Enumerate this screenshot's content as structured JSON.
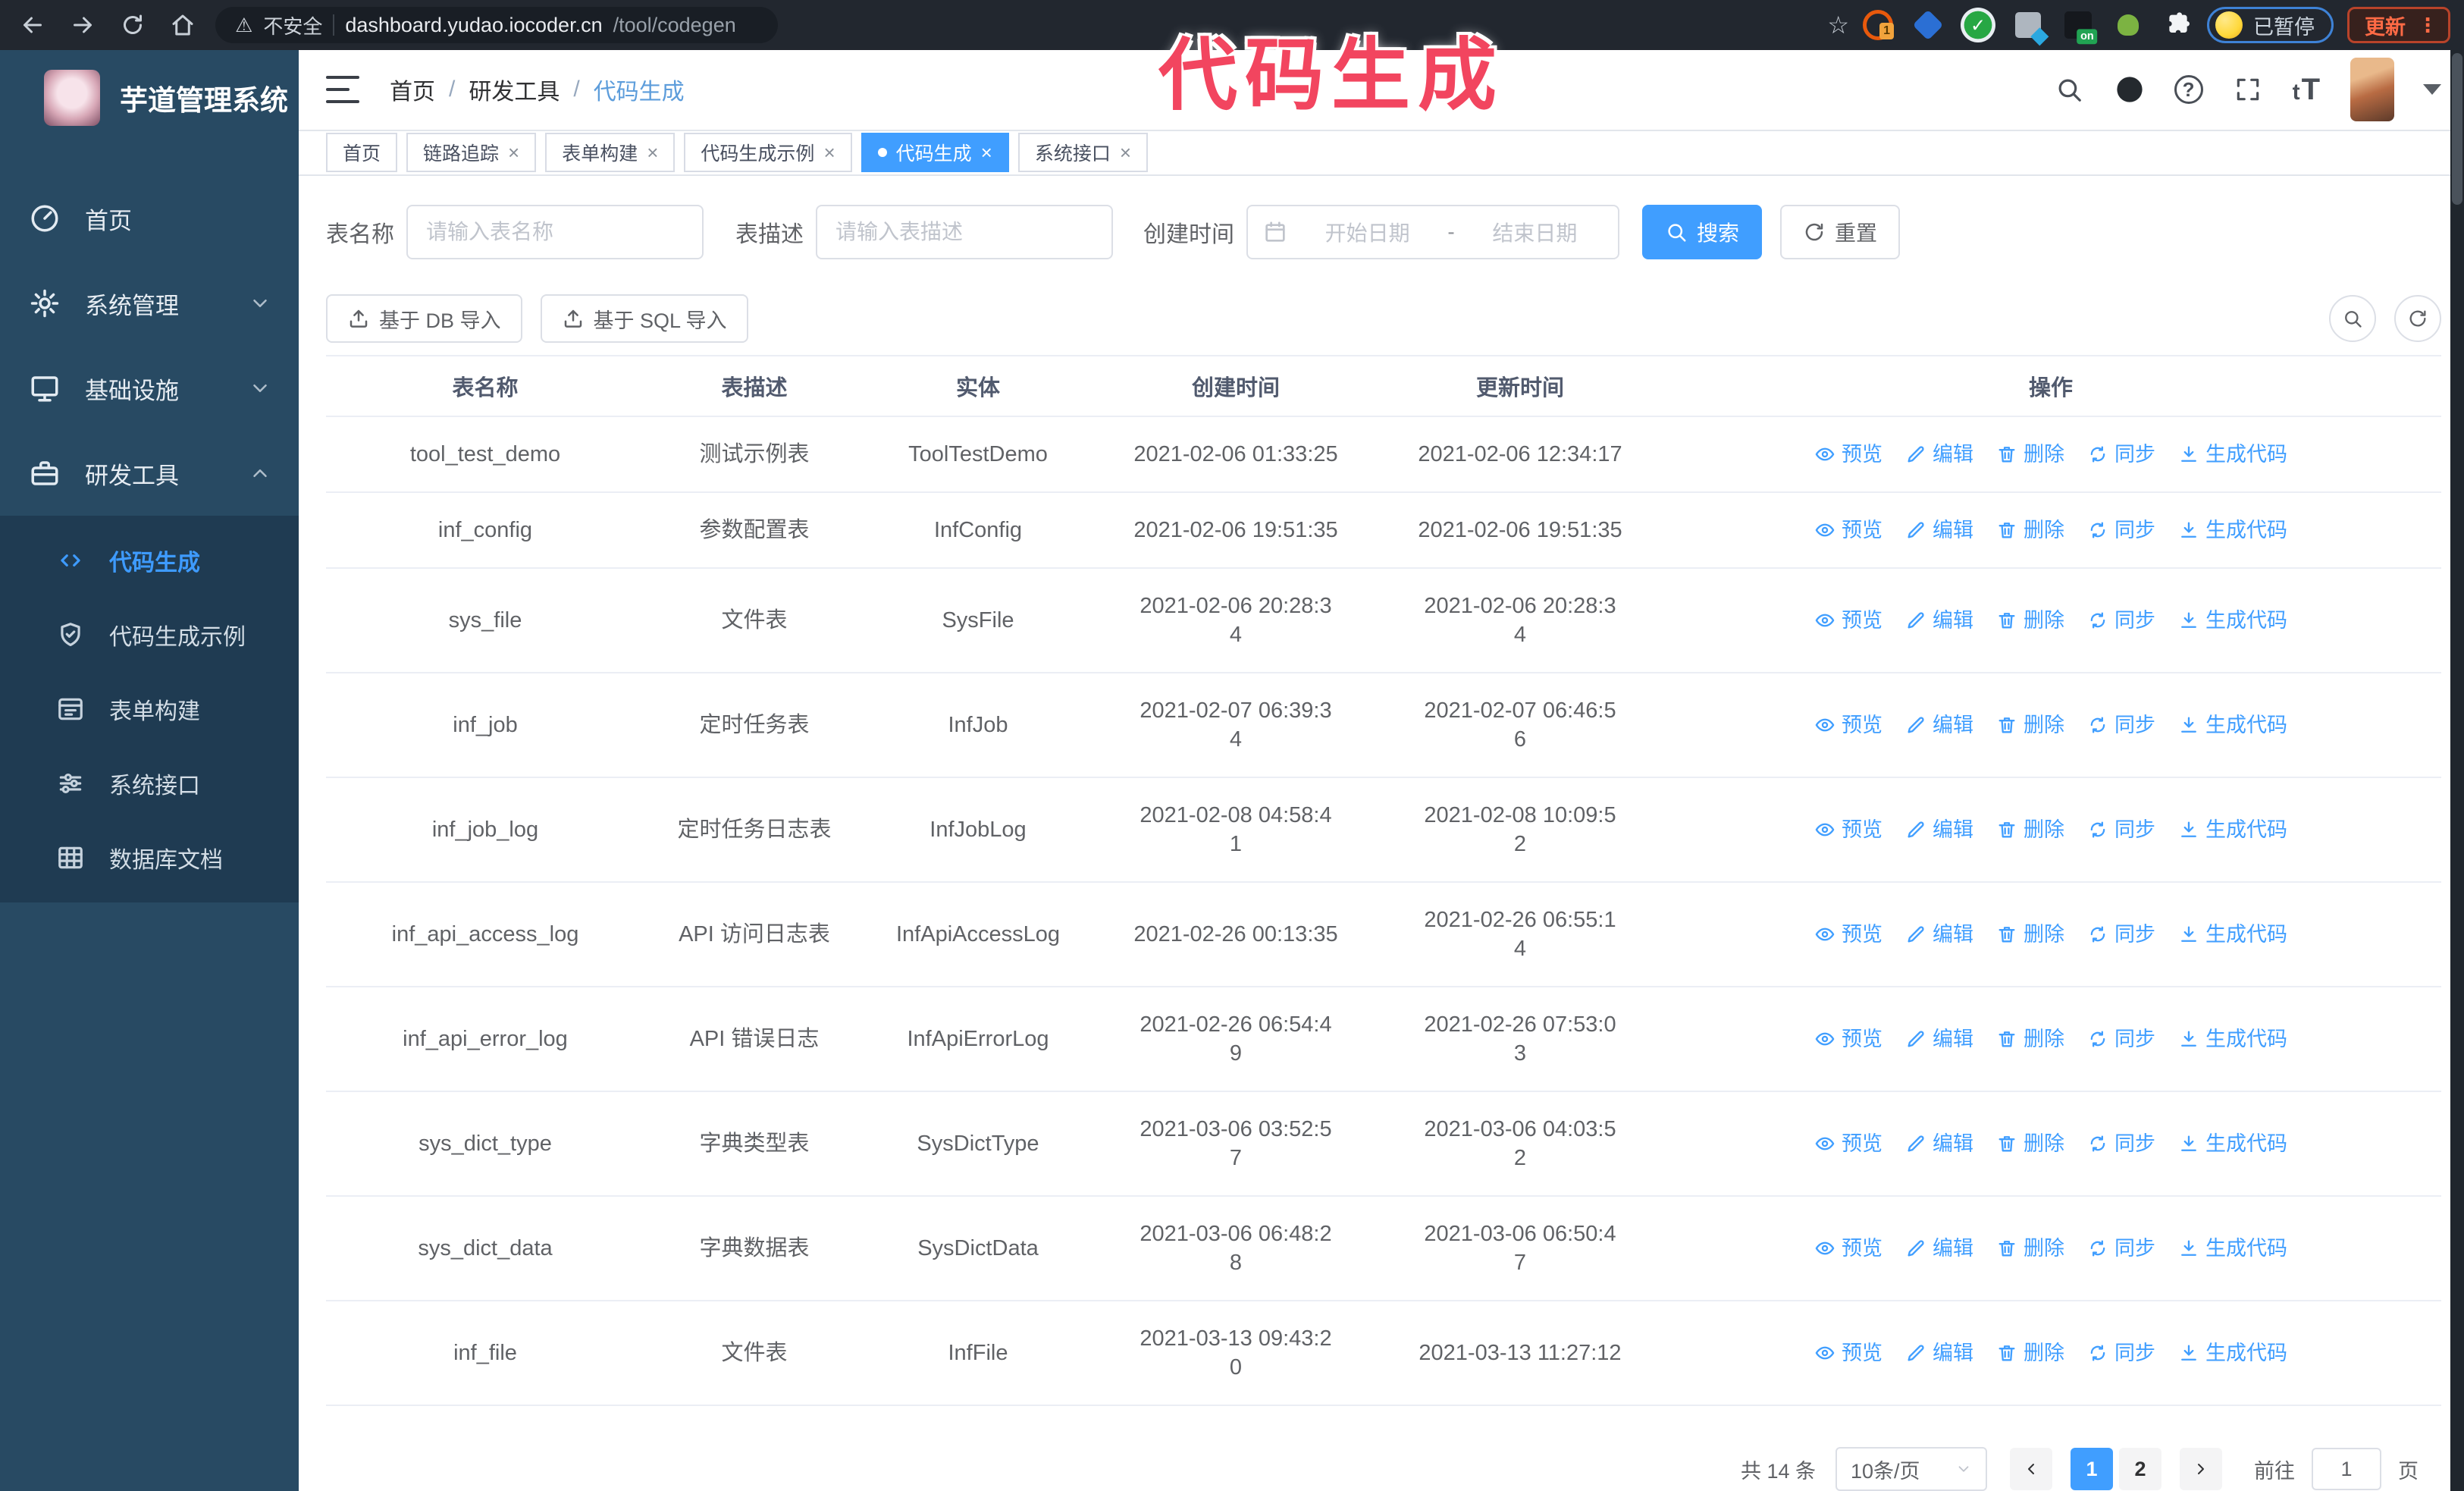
{
  "browser": {
    "security_label": "不安全",
    "url_host": "dashboard.yudao.iocoder.cn",
    "url_path": "/tool/codegen",
    "paused_badge": "已暂停",
    "update_button": "更新",
    "menu_dots": "⋮",
    "warning_glyph": "⚠",
    "star_glyph": "☆",
    "extensions": [
      {
        "name": "orange-extension-icon",
        "badge": "1"
      },
      {
        "name": "gem-extension-icon",
        "badge": ""
      },
      {
        "name": "green-check-extension-icon",
        "badge": "",
        "glyph": "✓"
      },
      {
        "name": "grid-extension-icon",
        "badge": ""
      },
      {
        "name": "dark-on-extension-icon",
        "badge": "on"
      },
      {
        "name": "green-bot-extension-icon",
        "badge": ""
      },
      {
        "name": "puzzle-extension-icon",
        "badge": ""
      }
    ]
  },
  "annotation": {
    "text": "代码生成",
    "color": "#f2455f"
  },
  "sidebar": {
    "title": "芋道管理系统",
    "items": [
      {
        "label": "首页",
        "icon": "dashboard",
        "type": "main"
      },
      {
        "label": "系统管理",
        "icon": "gear",
        "type": "main",
        "chevron": "down"
      },
      {
        "label": "基础设施",
        "icon": "monitor",
        "type": "main",
        "chevron": "down"
      },
      {
        "label": "研发工具",
        "icon": "toolbox",
        "type": "main",
        "chevron": "up"
      },
      {
        "label": "代码生成",
        "icon": "code",
        "type": "sub",
        "active": true
      },
      {
        "label": "代码生成示例",
        "icon": "shield",
        "type": "sub"
      },
      {
        "label": "表单构建",
        "icon": "form",
        "type": "sub"
      },
      {
        "label": "系统接口",
        "icon": "sliders",
        "type": "sub"
      },
      {
        "label": "数据库文档",
        "icon": "tablegrid",
        "type": "sub"
      }
    ]
  },
  "header": {
    "breadcrumb": [
      "首页",
      "研发工具",
      "代码生成"
    ],
    "separator": "/",
    "text_size_icon": "tT"
  },
  "tabs": [
    {
      "label": "首页",
      "closable": false,
      "active": false
    },
    {
      "label": "链路追踪",
      "closable": true,
      "active": false
    },
    {
      "label": "表单构建",
      "closable": true,
      "active": false
    },
    {
      "label": "代码生成示例",
      "closable": true,
      "active": false
    },
    {
      "label": "代码生成",
      "closable": true,
      "active": true
    },
    {
      "label": "系统接口",
      "closable": true,
      "active": false
    }
  ],
  "filters": {
    "table_name_label": "表名称",
    "table_name_placeholder": "请输入表名称",
    "table_desc_label": "表描述",
    "table_desc_placeholder": "请输入表描述",
    "create_time_label": "创建时间",
    "date_start_placeholder": "开始日期",
    "date_separator": "-",
    "date_end_placeholder": "结束日期",
    "search_button": "搜索",
    "reset_button": "重置"
  },
  "toolbar": {
    "import_db_button": "基于 DB 导入",
    "import_sql_button": "基于 SQL 导入"
  },
  "table": {
    "columns": [
      "表名称",
      "表描述",
      "实体",
      "创建时间",
      "更新时间",
      "操作"
    ],
    "row_actions": [
      "预览",
      "编辑",
      "删除",
      "同步",
      "生成代码"
    ],
    "action_icons": [
      "eye",
      "pencil",
      "trash",
      "sync",
      "download"
    ],
    "rows": [
      {
        "name": "tool_test_demo",
        "desc": "测试示例表",
        "entity": "ToolTestDemo",
        "create": "2021-02-06 01:33:25",
        "update": "2021-02-06 12:34:17"
      },
      {
        "name": "inf_config",
        "desc": "参数配置表",
        "entity": "InfConfig",
        "create": "2021-02-06 19:51:35",
        "update": "2021-02-06 19:51:35"
      },
      {
        "name": "sys_file",
        "desc": "文件表",
        "entity": "SysFile",
        "create": "2021-02-06 20:28:3\n4",
        "update": "2021-02-06 20:28:3\n4"
      },
      {
        "name": "inf_job",
        "desc": "定时任务表",
        "entity": "InfJob",
        "create": "2021-02-07 06:39:3\n4",
        "update": "2021-02-07 06:46:5\n6"
      },
      {
        "name": "inf_job_log",
        "desc": "定时任务日志表",
        "entity": "InfJobLog",
        "create": "2021-02-08 04:58:4\n1",
        "update": "2021-02-08 10:09:5\n2"
      },
      {
        "name": "inf_api_access_log",
        "desc": "API 访问日志表",
        "entity": "InfApiAccessLog",
        "create": "2021-02-26 00:13:35",
        "update": "2021-02-26 06:55:1\n4"
      },
      {
        "name": "inf_api_error_log",
        "desc": "API 错误日志",
        "entity": "InfApiErrorLog",
        "create": "2021-02-26 06:54:4\n9",
        "update": "2021-02-26 07:53:0\n3"
      },
      {
        "name": "sys_dict_type",
        "desc": "字典类型表",
        "entity": "SysDictType",
        "create": "2021-03-06 03:52:5\n7",
        "update": "2021-03-06 04:03:5\n2"
      },
      {
        "name": "sys_dict_data",
        "desc": "字典数据表",
        "entity": "SysDictData",
        "create": "2021-03-06 06:48:2\n8",
        "update": "2021-03-06 06:50:4\n7"
      },
      {
        "name": "inf_file",
        "desc": "文件表",
        "entity": "InfFile",
        "create": "2021-03-13 09:43:2\n0",
        "update": "2021-03-13 11:27:12"
      }
    ]
  },
  "pagination": {
    "total": "共 14 条",
    "page_size": "10条/页",
    "pages": [
      "1",
      "2"
    ],
    "active_page": "1",
    "goto_label": "前往",
    "goto_value": "1",
    "page_unit": "页"
  },
  "colors": {
    "accent": "#409eff",
    "sidebar_bg": "#284a63",
    "submenu_bg": "#1f3b52",
    "annotation": "#f2455f"
  }
}
